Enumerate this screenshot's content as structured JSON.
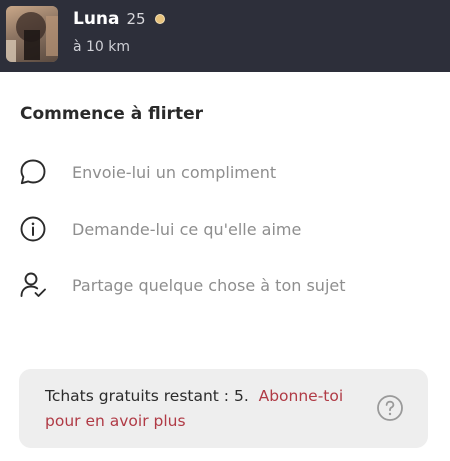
{
  "profile": {
    "name": "Luna",
    "age": "25",
    "distance": "à 10 km",
    "status_color": "#e7c27c"
  },
  "flirt": {
    "title": "Commence à flirter",
    "suggestions": [
      {
        "icon": "speech-bubble-icon",
        "label": "Envoie-lui un compliment"
      },
      {
        "icon": "info-icon",
        "label": "Demande-lui ce qu'elle aime"
      },
      {
        "icon": "user-check-icon",
        "label": "Partage quelque chose à ton sujet"
      }
    ]
  },
  "banner": {
    "text": "Tchats gratuits restant : 5.",
    "link": "Abonne-toi pour en avoir plus",
    "help_icon": "question-circle-icon",
    "link_color": "#b03a45"
  }
}
